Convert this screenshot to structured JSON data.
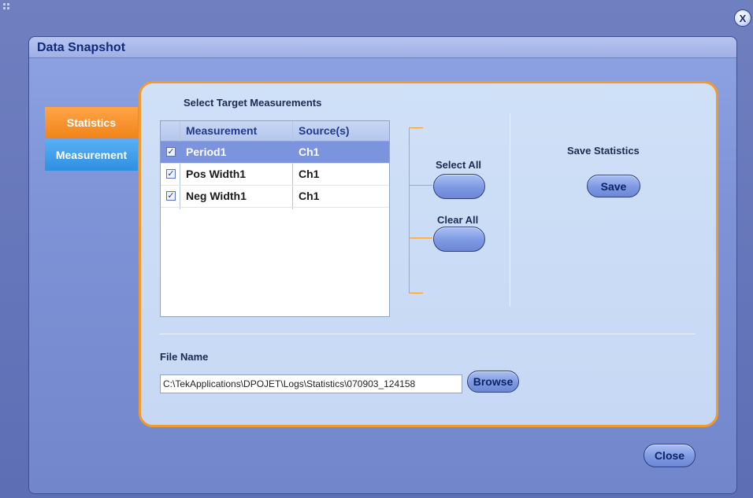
{
  "window": {
    "close_x_label": "X"
  },
  "dialog": {
    "title": "Data Snapshot"
  },
  "tabs": [
    {
      "label": "Statistics",
      "active": true
    },
    {
      "label": "Measurement",
      "active": false
    }
  ],
  "targets": {
    "heading": "Select Target Measurements",
    "columns": [
      "Measurement",
      "Source(s)"
    ],
    "rows": [
      {
        "checked": true,
        "measurement": "Period1",
        "source": "Ch1",
        "selected": true
      },
      {
        "checked": true,
        "measurement": "Pos Width1",
        "source": "Ch1",
        "selected": false
      },
      {
        "checked": true,
        "measurement": "Neg Width1",
        "source": "Ch1",
        "selected": false
      }
    ],
    "select_all_label": "Select All",
    "clear_all_label": "Clear All"
  },
  "save": {
    "heading": "Save Statistics",
    "button_label": "Save"
  },
  "file": {
    "label": "File Name",
    "value": "C:\\TekApplications\\DPOJET\\Logs\\Statistics\\070903_124158",
    "browse_label": "Browse"
  },
  "footer": {
    "close_label": "Close"
  },
  "colors": {
    "accent_orange": "#f39a2c",
    "tab_blue": "#2f8fe0",
    "selected_row": "#7c93de"
  }
}
